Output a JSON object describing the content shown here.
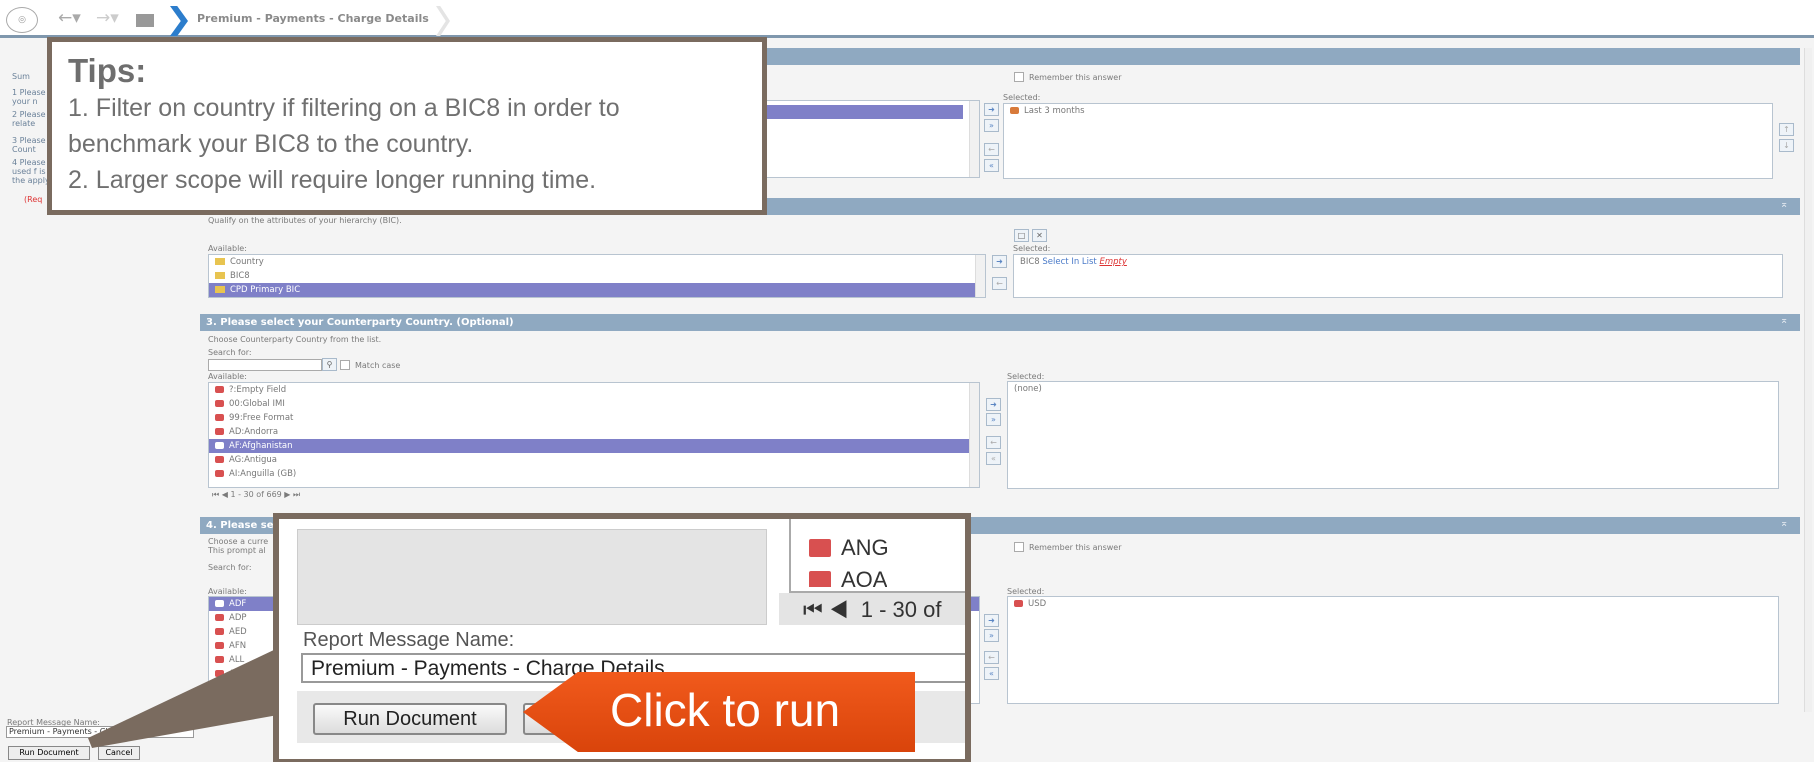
{
  "breadcrumb": {
    "title": "Premium - Payments - Charge Details"
  },
  "left_panel": {
    "summary": "Sum",
    "steps": [
      "1 Please your n",
      "2 Please relate",
      "3 Please Count",
      "4 Please used f is the apply"
    ],
    "required": "(Req"
  },
  "tips": {
    "title": "Tips:",
    "lines": [
      "1. Filter on country if filtering on a BIC8 in order to",
      "benchmark your BIC8 to the country.",
      "2. Larger scope will require longer running time."
    ]
  },
  "section1": {
    "remember": "Remember this answer",
    "selected_label": "Selected:",
    "selected_items": [
      "Last 3 months"
    ]
  },
  "section2": {
    "desc": "Qualify on the attributes of your hierarchy (BIC).",
    "available_label": "Available:",
    "selected_label": "Selected:",
    "available": [
      "Country",
      "BIC8",
      "CPD Primary BIC"
    ],
    "selected_prefix": "BIC8",
    "selected_mid": "Select In List",
    "selected_empty": "Empty"
  },
  "section3": {
    "title": "3. Please select your Counterparty Country. (Optional)",
    "desc": "Choose Counterparty Country from the list.",
    "search_label": "Search for:",
    "match_case": "Match case",
    "available_label": "Available:",
    "selected_label": "Selected:",
    "available": [
      "?:Empty Field",
      "00:Global IMI",
      "99:Free Format",
      "AD:Andorra",
      "AF:Afghanistan",
      "AG:Antigua",
      "AI:Anguilla (GB)"
    ],
    "selected_none": "(none)",
    "pager": "1 - 30 of 669"
  },
  "section4": {
    "title": "4. Please se",
    "desc1": "Choose a curre",
    "desc2": "This prompt al",
    "search_label": "Search for:",
    "available_label": "Available:",
    "selected_label": "Selected:",
    "remember": "Remember this answer",
    "available": [
      "ADF",
      "ADP",
      "AED",
      "AFN",
      "ALL",
      "AM"
    ],
    "selected_items": [
      "USD"
    ]
  },
  "footer": {
    "report_label": "Report Message Name:",
    "report_value": "Premium - Payments - Cha",
    "run_label": "Run Document",
    "cancel_label": "Cancel"
  },
  "zoom": {
    "list_item": "ANG",
    "list_item_cut": "AOA",
    "pager": "1 - 30 of",
    "report_label": "Report Message Name:",
    "report_value": "Premium - Payments - Charge Details",
    "run_label": "Run Document"
  },
  "callout": {
    "text": "Click to run"
  },
  "colors": {
    "header": "#8fa9c1",
    "accent": "#7f80c8",
    "callout": "#e84e10",
    "frame": "#7a6b5f"
  }
}
